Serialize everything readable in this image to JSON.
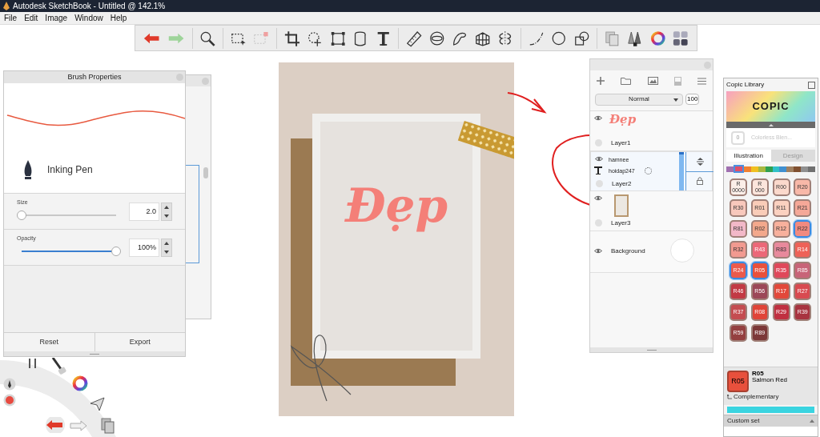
{
  "window": {
    "title": "Autodesk SketchBook - Untitled @ 142.1%"
  },
  "menu": [
    "File",
    "Edit",
    "Image",
    "Window",
    "Help"
  ],
  "brush_properties": {
    "title": "Brush Properties",
    "brush_name": "Inking Pen",
    "sliders": [
      {
        "label": "Size",
        "value": "2.0",
        "level": 0.0
      },
      {
        "label": "Opacity",
        "value": "100%",
        "level": 1.0
      }
    ],
    "buttons": [
      "Reset",
      "Export"
    ]
  },
  "canvas": {
    "text": "Đẹp"
  },
  "layers": {
    "blend_mode": "Normal",
    "opacity": "100",
    "items": [
      {
        "name": "Layer1",
        "kind": "image",
        "thumb_text": "Đẹp",
        "selected": false
      },
      {
        "name": "Layer2",
        "kind": "text",
        "lines": [
          "hamnee",
          "hoidap247"
        ],
        "selected": true
      },
      {
        "name": "Layer3",
        "kind": "image",
        "selected": false
      },
      {
        "name": "Background",
        "kind": "background",
        "selected": false
      }
    ]
  },
  "copic": {
    "title": "Copic Library",
    "logo": "COPIC",
    "blender_code": "0",
    "blender_name": "Colorless Blen...",
    "tabs": [
      {
        "label": "Illustration",
        "selected": true
      },
      {
        "label": "Design",
        "selected": false
      }
    ],
    "families": [
      {
        "color": "#a070b0",
        "selected": false
      },
      {
        "color": "#e05068",
        "selected": true
      },
      {
        "color": "#f08030",
        "selected": false
      },
      {
        "color": "#f0c020",
        "selected": false
      },
      {
        "color": "#a8b840",
        "selected": false
      },
      {
        "color": "#30a050",
        "selected": false
      },
      {
        "color": "#30c0c8",
        "selected": false
      },
      {
        "color": "#4090d0",
        "selected": false
      },
      {
        "color": "#a08060",
        "selected": false
      },
      {
        "color": "#805030",
        "selected": false
      },
      {
        "color": "#909090",
        "selected": false
      },
      {
        "color": "#707070",
        "selected": false
      }
    ],
    "swatches": [
      {
        "label": "R 0000",
        "color": "#fbeee8",
        "selected": false
      },
      {
        "label": "R 000",
        "color": "#fce5dc",
        "selected": false
      },
      {
        "label": "R00",
        "color": "#fbd9cc",
        "selected": false
      },
      {
        "label": "R20",
        "color": "#f8b8a8",
        "selected": false
      },
      {
        "label": "R30",
        "color": "#f8c8bc",
        "selected": false
      },
      {
        "label": "R01",
        "color": "#f9ccb8",
        "selected": false
      },
      {
        "label": "R11",
        "color": "#fbd1c0",
        "selected": false
      },
      {
        "label": "R21",
        "color": "#f5a898",
        "selected": false
      },
      {
        "label": "R81",
        "color": "#f2b8c8",
        "selected": false
      },
      {
        "label": "R02",
        "color": "#f3a88c",
        "selected": false
      },
      {
        "label": "R12",
        "color": "#f8b09c",
        "selected": false
      },
      {
        "label": "R22",
        "color": "#f18a80",
        "selected": true
      },
      {
        "label": "R32",
        "color": "#f29a90",
        "selected": false
      },
      {
        "label": "R43",
        "color": "#ec6878",
        "selected": false
      },
      {
        "label": "R83",
        "color": "#e8899c",
        "selected": false
      },
      {
        "label": "R14",
        "color": "#ee6258",
        "selected": false
      },
      {
        "label": "R24",
        "color": "#ea5a4c",
        "selected": true
      },
      {
        "label": "R05",
        "color": "#e8503c",
        "selected": true
      },
      {
        "label": "R35",
        "color": "#e0485a",
        "selected": false
      },
      {
        "label": "R85",
        "color": "#c86478",
        "selected": false
      },
      {
        "label": "R46",
        "color": "#c23a44",
        "selected": false
      },
      {
        "label": "R56",
        "color": "#9c4858",
        "selected": false
      },
      {
        "label": "R17",
        "color": "#e2483a",
        "selected": false
      },
      {
        "label": "R27",
        "color": "#d84a50",
        "selected": false
      },
      {
        "label": "R37",
        "color": "#c44c50",
        "selected": false
      },
      {
        "label": "R08",
        "color": "#e04438",
        "selected": false
      },
      {
        "label": "R29",
        "color": "#c03040",
        "selected": false
      },
      {
        "label": "R39",
        "color": "#a83440",
        "selected": false
      },
      {
        "label": "R59",
        "color": "#944040",
        "selected": false
      },
      {
        "label": "R89",
        "color": "#7c3838",
        "selected": false
      }
    ],
    "current": {
      "code": "R05",
      "title": "R05",
      "name": "Salmon Red",
      "color": "#e8503c"
    },
    "complementary": "Complementary",
    "custom_set": "Custom set"
  }
}
